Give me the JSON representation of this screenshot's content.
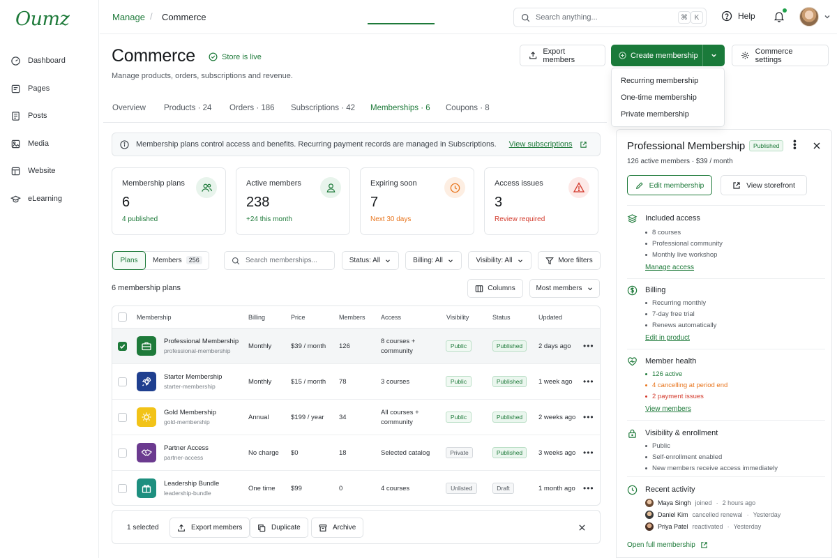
{
  "brand": {
    "logo": "Oumz",
    "accent": "#1a7a3a"
  },
  "sidebar": {
    "items": [
      {
        "label": "Dashboard",
        "icon": "dashboard-icon"
      },
      {
        "label": "Pages",
        "icon": "pages-icon"
      },
      {
        "label": "Posts",
        "icon": "posts-icon"
      },
      {
        "label": "Media",
        "icon": "image-icon"
      },
      {
        "label": "Website",
        "icon": "website-icon"
      },
      {
        "label": "eLearning",
        "icon": "graduation-cap-icon"
      }
    ]
  },
  "topbar": {
    "breadcrumb": [
      "Manage",
      "Commerce"
    ],
    "search_placeholder": "Search anything...",
    "shortcut": [
      "⌘",
      "K"
    ],
    "help_label": "Help"
  },
  "header": {
    "title": "Commerce",
    "status": "Store is live",
    "subtitle": "Manage products, orders, subscriptions and revenue.",
    "export_label": "Export members",
    "create_label": "Create membership",
    "settings_label": "Commerce settings",
    "create_menu": [
      "Recurring membership",
      "One-time membership",
      "Private membership"
    ]
  },
  "tabs": [
    {
      "label": "Overview"
    },
    {
      "label": "Products · 24"
    },
    {
      "label": "Orders · 186"
    },
    {
      "label": "Subscriptions · 42"
    },
    {
      "label": "Memberships · 6"
    },
    {
      "label": "Coupons · 8"
    }
  ],
  "info": {
    "text": "Membership plans control access and benefits. Recurring payment records are managed in Subscriptions.",
    "link": "View subscriptions"
  },
  "stats": [
    {
      "label": "Membership plans",
      "value": "6",
      "sub": "4 published",
      "sub_color": "#1e7a3a"
    },
    {
      "label": "Active members",
      "value": "238",
      "sub": "+24 this month",
      "sub_color": "#1e7a3a"
    },
    {
      "label": "Expiring soon",
      "value": "7",
      "sub": "Next 30 days",
      "sub_color": "#e8741c"
    },
    {
      "label": "Access issues",
      "value": "3",
      "sub": "Review required",
      "sub_color": "#d33a2c"
    }
  ],
  "toolbar": {
    "seg_plans": "Plans",
    "seg_members": "Members",
    "seg_members_count": "256",
    "search_placeholder": "Search memberships...",
    "status_filter": "Status: All",
    "billing_filter": "Billing: All",
    "visibility_filter": "Visibility: All",
    "more_filters": "More filters",
    "count_label": "6 membership plans",
    "columns_label": "Columns",
    "sort_label": "Most members"
  },
  "table": {
    "headers": [
      "Membership",
      "Billing",
      "Price",
      "Members",
      "Access",
      "Visibility",
      "Status",
      "Updated"
    ],
    "rows": [
      {
        "name": "Professional Membership",
        "slug": "professional-membership",
        "billing": "Monthly",
        "price": "$39 / month",
        "members": "126",
        "access": [
          "8 courses +",
          "community"
        ],
        "visibility": "Public",
        "status": "Published",
        "updated": "2 days ago",
        "icon": "briefcase-icon",
        "icon_bg": "#1e7a3a",
        "selected": true
      },
      {
        "name": "Starter Membership",
        "slug": "starter-membership",
        "billing": "Monthly",
        "price": "$15 / month",
        "members": "78",
        "access": [
          "3 courses"
        ],
        "visibility": "Public",
        "status": "Published",
        "updated": "1 week ago",
        "icon": "rocket-icon",
        "icon_bg": "#1f3f8f",
        "selected": false
      },
      {
        "name": "Gold Membership",
        "slug": "gold-membership",
        "billing": "Annual",
        "price": "$199 / year",
        "members": "34",
        "access": [
          "All courses +",
          "community"
        ],
        "visibility": "Public",
        "status": "Published",
        "updated": "2 weeks ago",
        "icon": "star-badge-icon",
        "icon_bg": "#f2c318",
        "selected": false
      },
      {
        "name": "Partner Access",
        "slug": "partner-access",
        "billing": "No charge",
        "price": "$0",
        "members": "18",
        "access": [
          "Selected catalog"
        ],
        "visibility": "Private",
        "status": "Published",
        "updated": "3 weeks ago",
        "icon": "handshake-icon",
        "icon_bg": "#6b3a8f",
        "selected": false
      },
      {
        "name": "Leadership Bundle",
        "slug": "leadership-bundle",
        "billing": "One time",
        "price": "$99",
        "members": "0",
        "access": [
          "4 courses"
        ],
        "visibility": "Unlisted",
        "status": "Draft",
        "updated": "1 month ago",
        "icon": "gift-icon",
        "icon_bg": "#1e8f7f",
        "selected": false
      }
    ]
  },
  "bulk": {
    "selected": "1 selected",
    "export": "Export members",
    "duplicate": "Duplicate",
    "archive": "Archive"
  },
  "panel": {
    "title": "Professional Membership",
    "badge": "Published",
    "sub": "126 active members · $39 / month",
    "edit": "Edit membership",
    "storefront": "View storefront",
    "included": {
      "title": "Included access",
      "items": [
        "8 courses",
        "Professional community",
        "Monthly live workshop"
      ],
      "link": "Manage access"
    },
    "billing": {
      "title": "Billing",
      "items": [
        "Recurring monthly",
        "7-day free trial",
        "Renews automatically"
      ],
      "link": "Edit in product"
    },
    "health": {
      "title": "Member health",
      "items": [
        "126 active",
        "4 cancelling at period end",
        "2 payment issues"
      ],
      "link": "View members"
    },
    "visibility": {
      "title": "Visibility & enrollment",
      "items": [
        "Public",
        "Self-enrollment enabled",
        "New members receive access immediately"
      ]
    },
    "activity": {
      "title": "Recent activity",
      "items": [
        {
          "name": "Maya Singh",
          "verb": "joined",
          "time": "2 hours ago"
        },
        {
          "name": "Daniel Kim",
          "verb": "cancelled renewal",
          "time": "Yesterday"
        },
        {
          "name": "Priya Patel",
          "verb": "reactivated",
          "time": "Yesterday"
        }
      ]
    },
    "footer_link": "Open full membership"
  }
}
